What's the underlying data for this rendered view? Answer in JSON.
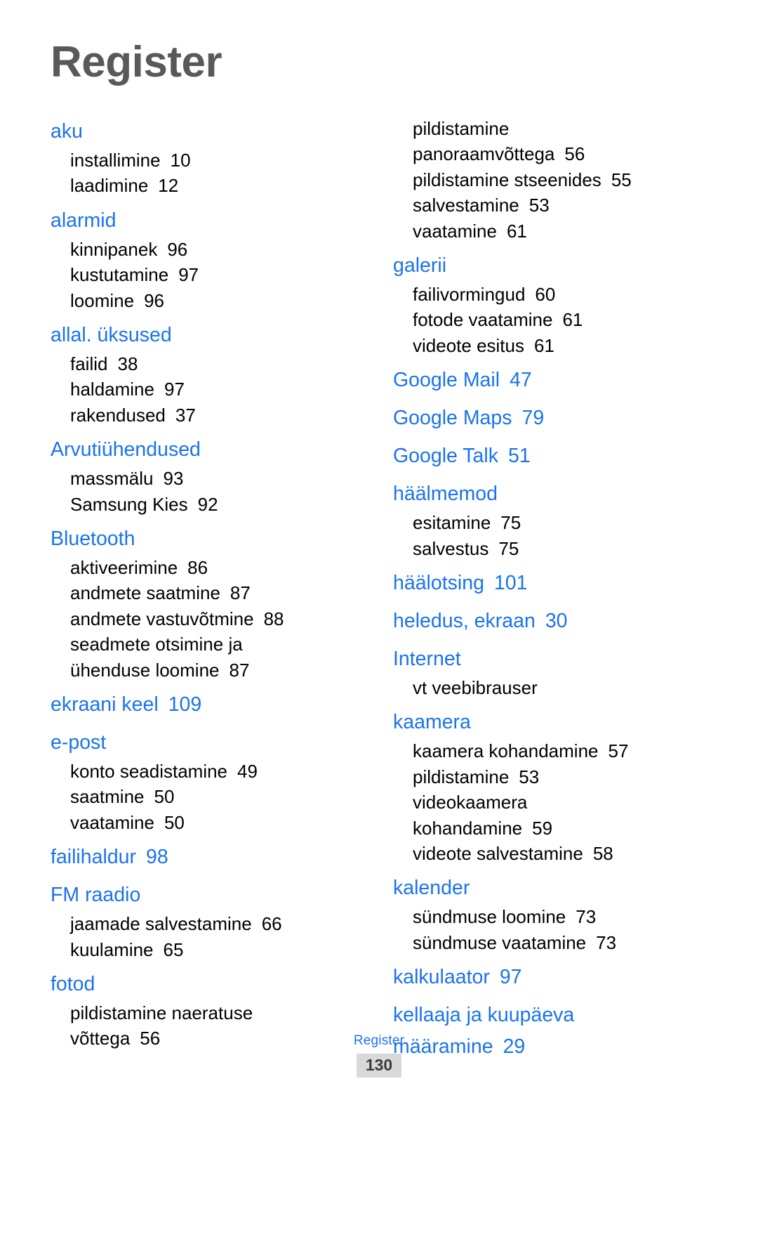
{
  "page_title": "Register",
  "colors": {
    "heading": "#1a73f0",
    "body": "#000000",
    "title": "#58595b",
    "badge_bg": "#d9d9d9"
  },
  "footer": {
    "label": "Register",
    "page_number": "130"
  },
  "columns": [
    {
      "name": "left-column",
      "entries": [
        {
          "heading": "aku",
          "page": "",
          "subs": [
            {
              "text": "installimine",
              "page": "10"
            },
            {
              "text": "laadimine",
              "page": "12"
            }
          ]
        },
        {
          "heading": "alarmid",
          "page": "",
          "subs": [
            {
              "text": "kinnipanek",
              "page": "96"
            },
            {
              "text": "kustutamine",
              "page": "97"
            },
            {
              "text": "loomine",
              "page": "96"
            }
          ]
        },
        {
          "heading": "allal. üksused",
          "page": "",
          "subs": [
            {
              "text": "failid",
              "page": "38"
            },
            {
              "text": "haldamine",
              "page": "97"
            },
            {
              "text": "rakendused",
              "page": "37"
            }
          ]
        },
        {
          "heading": "Arvutiühendused",
          "page": "",
          "subs": [
            {
              "text": "massmälu",
              "page": "93"
            },
            {
              "text": "Samsung Kies",
              "page": "92"
            }
          ]
        },
        {
          "heading": "Bluetooth",
          "page": "",
          "subs": [
            {
              "text": "aktiveerimine",
              "page": "86"
            },
            {
              "text": "andmete saatmine",
              "page": "87"
            },
            {
              "text": "andmete vastuvõtmine",
              "page": "88"
            },
            {
              "text": "seadmete otsimine ja",
              "page": ""
            },
            {
              "text": "ühenduse loomine",
              "page": "87"
            }
          ]
        },
        {
          "heading": "ekraani keel",
          "page": "109",
          "subs": []
        },
        {
          "heading": "e-post",
          "page": "",
          "subs": [
            {
              "text": "konto seadistamine",
              "page": "49"
            },
            {
              "text": "saatmine",
              "page": "50"
            },
            {
              "text": "vaatamine",
              "page": "50"
            }
          ]
        },
        {
          "heading": "failihaldur",
          "page": "98",
          "subs": []
        },
        {
          "heading": "FM raadio",
          "page": "",
          "subs": [
            {
              "text": "jaamade salvestamine",
              "page": "66"
            },
            {
              "text": "kuulamine",
              "page": "65"
            }
          ]
        },
        {
          "heading": "fotod",
          "page": "",
          "subs": [
            {
              "text": "pildistamine naeratuse",
              "page": ""
            },
            {
              "text": "võttega",
              "page": "56"
            }
          ]
        }
      ]
    },
    {
      "name": "right-column",
      "entries": [
        {
          "heading": "",
          "page": "",
          "subs": [
            {
              "text": "pildistamine",
              "page": ""
            },
            {
              "text": "panoraamvõttega",
              "page": "56"
            },
            {
              "text": "pildistamine stseenides",
              "page": "55"
            },
            {
              "text": "salvestamine",
              "page": "53"
            },
            {
              "text": "vaatamine",
              "page": "61"
            }
          ]
        },
        {
          "heading": "galerii",
          "page": "",
          "subs": [
            {
              "text": "failivormingud",
              "page": "60"
            },
            {
              "text": "fotode vaatamine",
              "page": "61"
            },
            {
              "text": "videote esitus",
              "page": "61"
            }
          ]
        },
        {
          "heading": "Google Mail",
          "page": "47",
          "subs": []
        },
        {
          "heading": "Google Maps",
          "page": "79",
          "subs": []
        },
        {
          "heading": "Google Talk",
          "page": "51",
          "subs": []
        },
        {
          "heading": "häälmemod",
          "page": "",
          "subs": [
            {
              "text": "esitamine",
              "page": "75"
            },
            {
              "text": "salvestus",
              "page": "75"
            }
          ]
        },
        {
          "heading": "häälotsing",
          "page": "101",
          "subs": []
        },
        {
          "heading": "heledus, ekraan",
          "page": "30",
          "subs": []
        },
        {
          "heading": "Internet",
          "page": "",
          "subs": [
            {
              "text": "vt veebibrauser",
              "page": ""
            }
          ]
        },
        {
          "heading": "kaamera",
          "page": "",
          "subs": [
            {
              "text": "kaamera kohandamine",
              "page": "57"
            },
            {
              "text": "pildistamine",
              "page": "53"
            },
            {
              "text": "videokaamera",
              "page": ""
            },
            {
              "text": "kohandamine",
              "page": "59"
            },
            {
              "text": "videote salvestamine",
              "page": "58"
            }
          ]
        },
        {
          "heading": "kalender",
          "page": "",
          "subs": [
            {
              "text": "sündmuse loomine",
              "page": "73"
            },
            {
              "text": "sündmuse vaatamine",
              "page": "73"
            }
          ]
        },
        {
          "heading": "kalkulaator",
          "page": "97",
          "subs": []
        },
        {
          "heading": "kellaaja ja kuupäeva",
          "page": "",
          "subs": [],
          "heading_line2": "määramine",
          "heading_line2_page": "29"
        }
      ]
    }
  ]
}
